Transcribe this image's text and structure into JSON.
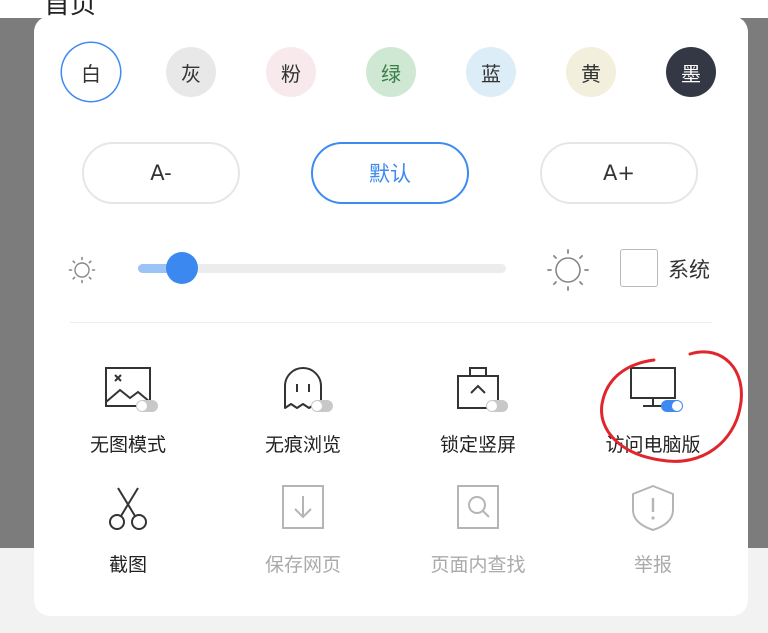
{
  "background": {
    "title": "首页"
  },
  "themes": [
    {
      "label": "白",
      "bg": "#ffffff",
      "color": "#333333",
      "selected": true
    },
    {
      "label": "灰",
      "bg": "#e8e8e8",
      "color": "#333333",
      "selected": false
    },
    {
      "label": "粉",
      "bg": "#f7e9ec",
      "color": "#333333",
      "selected": false
    },
    {
      "label": "绿",
      "bg": "#cfe8d3",
      "color": "#3a7f4a",
      "selected": false
    },
    {
      "label": "蓝",
      "bg": "#dcedf8",
      "color": "#333333",
      "selected": false
    },
    {
      "label": "黄",
      "bg": "#f2f0dc",
      "color": "#333333",
      "selected": false
    },
    {
      "label": "墨",
      "bg": "#333844",
      "color": "#ffffff",
      "selected": false
    }
  ],
  "font_size": {
    "decrease": "A-",
    "default": "默认",
    "increase": "A+"
  },
  "brightness": {
    "level": 0.12,
    "system_label": "系统",
    "system_checked": false
  },
  "features_row1": [
    {
      "label": "无图模式",
      "icon": "no-image-icon",
      "toggle_on": false
    },
    {
      "label": "无痕浏览",
      "icon": "ghost-icon",
      "toggle_on": false
    },
    {
      "label": "锁定竖屏",
      "icon": "lock-screen-icon",
      "toggle_on": false
    },
    {
      "label": "访问电脑版",
      "icon": "desktop-icon",
      "toggle_on": true
    }
  ],
  "features_row2": [
    {
      "label": "截图",
      "icon": "scissors-icon",
      "disabled": false
    },
    {
      "label": "保存网页",
      "icon": "save-page-icon",
      "disabled": true
    },
    {
      "label": "页面内查找",
      "icon": "find-in-page-icon",
      "disabled": true
    },
    {
      "label": "举报",
      "icon": "report-icon",
      "disabled": true
    }
  ],
  "colors": {
    "accent": "#3d8af0",
    "annotation": "#e0262c",
    "toggle_off": "#c8c8c8"
  }
}
